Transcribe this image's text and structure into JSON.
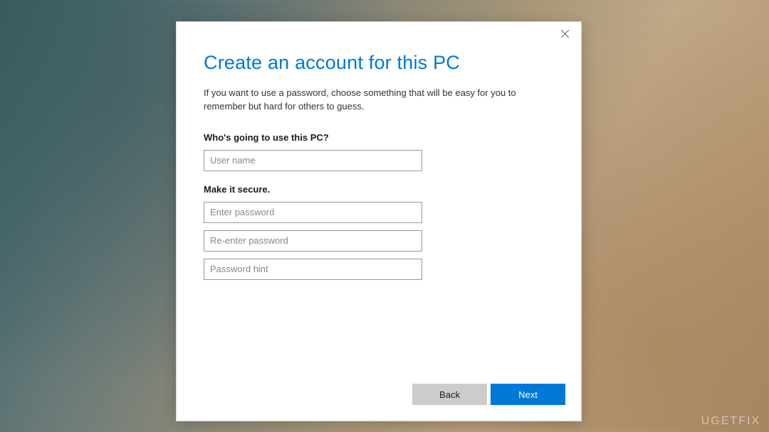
{
  "dialog": {
    "title": "Create an account for this PC",
    "description": "If you want to use a password, choose something that will be easy for you to remember but hard for others to guess.",
    "section1": {
      "label": "Who's going to use this PC?",
      "username_placeholder": "User name"
    },
    "section2": {
      "label": "Make it secure.",
      "password_placeholder": "Enter password",
      "password_confirm_placeholder": "Re-enter password",
      "hint_placeholder": "Password hint"
    },
    "buttons": {
      "back": "Back",
      "next": "Next"
    }
  },
  "watermark": "UGETFIX"
}
